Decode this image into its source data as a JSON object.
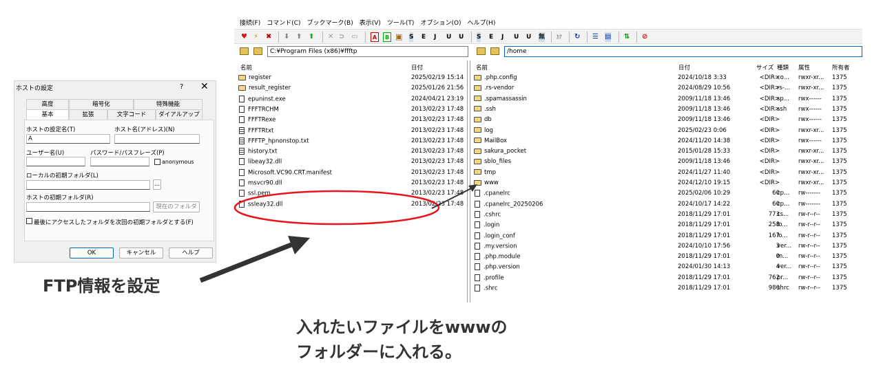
{
  "dialog": {
    "title": "ホストの設定",
    "help_glyph": "?",
    "close_glyph": "✕",
    "tabs_row1": [
      "高度",
      "暗号化",
      "特殊機能"
    ],
    "tabs_row2": [
      "基本",
      "拡張",
      "文字コード",
      "ダイアルアップ"
    ],
    "host_setting_name_label": "ホストの設定名(T)",
    "host_setting_name_value": "A",
    "host_address_label": "ホスト名(アドレス)(N)",
    "host_address_value": "",
    "username_label": "ユーザー名(U)",
    "password_label": "パスワード/パスフレーズ(P)",
    "anonymous_label": "anonymous",
    "local_folder_label": "ローカルの初期フォルダ(L)",
    "browse_label": "...",
    "host_folder_label": "ホストの初期フォルダ(R)",
    "current_folder_label": "現在のフォルダ",
    "last_folder_checkbox_label": "最後にアクセスしたフォルダを次回の初期フォルダとする(F)",
    "ok_label": "OK",
    "cancel_label": "キャンセル",
    "help_label": "ヘルプ"
  },
  "menu": [
    "接続(F)",
    "コマンド(C)",
    "ブックマーク(B)",
    "表示(V)",
    "ツール(T)",
    "オプション(O)",
    "ヘルプ(H)"
  ],
  "toolbar": {
    "transfer_buttons": [
      "S",
      "E",
      "J",
      "U",
      "U",
      "S",
      "E",
      "J",
      "U",
      "U",
      "無"
    ],
    "kana_label": "ｶﾅ"
  },
  "local": {
    "path": "C:¥Program Files (x86)¥ffftp",
    "col_name": "名前",
    "col_date": "日付",
    "files": [
      {
        "name": "register",
        "date": "2025/02/19 15:14",
        "type": "folder"
      },
      {
        "name": "result_register",
        "date": "2025/01/26 21:56",
        "type": "folder"
      },
      {
        "name": "epuninst.exe",
        "date": "2024/04/21 23:19",
        "type": "file"
      },
      {
        "name": "FFFTRCHM",
        "date": "2013/02/23 17:48",
        "type": "file"
      },
      {
        "name": "FFFTRexe",
        "date": "2013/02/23 17:48",
        "type": "file"
      },
      {
        "name": "FFFTRtxt",
        "date": "2013/02/23 17:48",
        "type": "txt"
      },
      {
        "name": "FFFTP_hpnonstop.txt",
        "date": "2013/02/23 17:48",
        "type": "txt"
      },
      {
        "name": "history.txt",
        "date": "2013/02/23 17:48",
        "type": "txt"
      },
      {
        "name": "libeay32.dll",
        "date": "2013/02/23 17:48",
        "type": "file"
      },
      {
        "name": "Microsoft.VC90.CRT.manifest",
        "date": "2013/02/23 17:48",
        "type": "file"
      },
      {
        "name": "msvcr90.dll",
        "date": "2013/02/23 17:48",
        "type": "file"
      },
      {
        "name": "ssl.pem",
        "date": "2013/02/23 17:48",
        "type": "file"
      },
      {
        "name": "ssleay32.dll",
        "date": "2013/02/23 17:48",
        "type": "file"
      }
    ]
  },
  "remote": {
    "path": "/home",
    "col_name": "名前",
    "col_date": "日付",
    "col_size": "サイズ",
    "col_kind": "種類",
    "col_attr": "属性",
    "col_owner": "所有者",
    "files": [
      {
        "name": ".php.config",
        "date": "2024/10/18  3:33",
        "size": "<DIR>",
        "kind": "co...",
        "attr": "rwxr-xr...",
        "owner": "1375",
        "type": "folder"
      },
      {
        "name": ".rs-vendor",
        "date": "2024/08/29 10:56",
        "size": "<DIR>",
        "kind": "rs-...",
        "attr": "rwxr-xr...",
        "owner": "1375",
        "type": "folder"
      },
      {
        "name": ".spamassassin",
        "date": "2009/11/18 13:46",
        "size": "<DIR>",
        "kind": "sp...",
        "attr": "rwx------",
        "owner": "1375",
        "type": "folder"
      },
      {
        "name": ".ssh",
        "date": "2009/11/18 13:46",
        "size": "<DIR>",
        "kind": "ssh",
        "attr": "rwx------",
        "owner": "1375",
        "type": "folder"
      },
      {
        "name": "db",
        "date": "2009/11/18 13:46",
        "size": "<DIR>",
        "kind": "",
        "attr": "rwx------",
        "owner": "1375",
        "type": "folder"
      },
      {
        "name": "log",
        "date": "2025/02/23  0:06",
        "size": "<DIR>",
        "kind": "",
        "attr": "rwxr-xr...",
        "owner": "1375",
        "type": "folder"
      },
      {
        "name": "MailBox",
        "date": "2024/11/20 14:38",
        "size": "<DIR>",
        "kind": "",
        "attr": "rwx------",
        "owner": "1375",
        "type": "folder"
      },
      {
        "name": "sakura_pocket",
        "date": "2015/01/28 15:33",
        "size": "<DIR>",
        "kind": "",
        "attr": "rwxr-xr...",
        "owner": "1375",
        "type": "folder"
      },
      {
        "name": "sblo_files",
        "date": "2009/11/18 13:46",
        "size": "<DIR>",
        "kind": "",
        "attr": "rwxr-xr...",
        "owner": "1375",
        "type": "folder"
      },
      {
        "name": "tmp",
        "date": "2024/11/27 11:40",
        "size": "<DIR>",
        "kind": "",
        "attr": "rwxr-xr...",
        "owner": "1375",
        "type": "folder"
      },
      {
        "name": "www",
        "date": "2024/12/10 19:15",
        "size": "<DIR>",
        "kind": "",
        "attr": "rwxr-xr...",
        "owner": "1375",
        "type": "folder"
      },
      {
        "name": ".cpanelrc",
        "date": "2025/02/06 10:29",
        "size": "60",
        "kind": "cp...",
        "attr": "rw-------",
        "owner": "1375",
        "type": "file"
      },
      {
        "name": ".cpanelrc_20250206",
        "date": "2024/10/17 14:22",
        "size": "60",
        "kind": "cp...",
        "attr": "rw-------",
        "owner": "1375",
        "type": "file"
      },
      {
        "name": ".cshrc",
        "date": "2018/11/29 17:01",
        "size": "773",
        "kind": "cs...",
        "attr": "rw-r--r--",
        "owner": "1375",
        "type": "file"
      },
      {
        "name": ".login",
        "date": "2018/11/29 17:01",
        "size": "258",
        "kind": "lo...",
        "attr": "rw-r--r--",
        "owner": "1375",
        "type": "file"
      },
      {
        "name": ".login_conf",
        "date": "2018/11/29 17:01",
        "size": "167",
        "kind": "lo...",
        "attr": "rw-r--r--",
        "owner": "1375",
        "type": "file"
      },
      {
        "name": ".my.version",
        "date": "2024/10/10 17:56",
        "size": "3",
        "kind": "ver...",
        "attr": "rw-r--r--",
        "owner": "1375",
        "type": "file"
      },
      {
        "name": ".php.module",
        "date": "2018/11/29 17:01",
        "size": "0",
        "kind": "m...",
        "attr": "rw-r--r--",
        "owner": "1375",
        "type": "file"
      },
      {
        "name": ".php.version",
        "date": "2024/01/30 14:13",
        "size": "4",
        "kind": "ver...",
        "attr": "rw-r--r--",
        "owner": "1375",
        "type": "file"
      },
      {
        "name": ".profile",
        "date": "2018/11/29 17:01",
        "size": "762",
        "kind": "pr...",
        "attr": "rw-r--r--",
        "owner": "1375",
        "type": "file"
      },
      {
        "name": ".shrc",
        "date": "2018/11/29 17:01",
        "size": "980",
        "kind": "shrc",
        "attr": "rw-r--r--",
        "owner": "1375",
        "type": "file"
      }
    ]
  },
  "annotations": {
    "ftp_note": "FTP情報を設定",
    "www_note_line1": "入れたいファイルをwwwの",
    "www_note_line2": "フォルダーに入れる。",
    "highlight_color": "#e8141c",
    "arrow_color": "#333333"
  }
}
